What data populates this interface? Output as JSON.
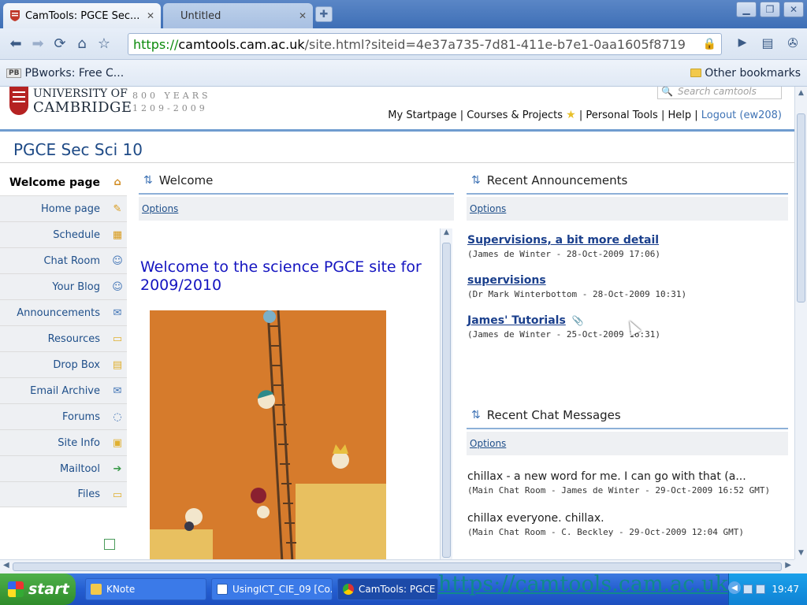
{
  "browser": {
    "tabs": [
      {
        "title": "CamTools: PGCE Sec...",
        "active": true
      },
      {
        "title": "Untitled",
        "active": false
      }
    ],
    "address": {
      "scheme": "https://",
      "host": "camtools.cam.ac.uk",
      "path": "/site.html?siteid=4e37a735-7d81-411e-b7e1-0aa1605f8719"
    },
    "bookmarks": {
      "left": "PBworks: Free C...",
      "left_badge": "PB",
      "right": "Other bookmarks"
    }
  },
  "header": {
    "university_line1": "UNIVERSITY OF",
    "university_line2": "CAMBRIDGE",
    "years_line1": "800 YEARS",
    "years_line2": "1209-2009",
    "search_placeholder": "Search camtools",
    "nav": {
      "startpage": "My Startpage",
      "courses": "Courses & Projects",
      "personal": "Personal Tools",
      "help": "Help",
      "logout": "Logout (ew208)"
    }
  },
  "site_title": "PGCE Sec Sci 10",
  "sidebar": {
    "items": [
      {
        "label": "Welcome page",
        "icon": "home-icon",
        "glyph": "⌂",
        "color": "#d08a1e"
      },
      {
        "label": "Home page",
        "icon": "pencil-icon",
        "glyph": "✎",
        "color": "#d89a1a"
      },
      {
        "label": "Schedule",
        "icon": "calendar-icon",
        "glyph": "▦",
        "color": "#d89a1a"
      },
      {
        "label": "Chat Room",
        "icon": "chat-person-icon",
        "glyph": "☺",
        "color": "#3f73b5"
      },
      {
        "label": "Your Blog",
        "icon": "blog-person-icon",
        "glyph": "☺",
        "color": "#3f73b5"
      },
      {
        "label": "Announcements",
        "icon": "megaphone-icon",
        "glyph": "✉",
        "color": "#3f73b5"
      },
      {
        "label": "Resources",
        "icon": "folder-icon",
        "glyph": "▭",
        "color": "#e0b030"
      },
      {
        "label": "Drop Box",
        "icon": "dropbox-icon",
        "glyph": "▤",
        "color": "#e0b030"
      },
      {
        "label": "Email Archive",
        "icon": "envelope-icon",
        "glyph": "✉",
        "color": "#3f73b5"
      },
      {
        "label": "Forums",
        "icon": "speech-bubble-icon",
        "glyph": "◌",
        "color": "#3f73b5"
      },
      {
        "label": "Site Info",
        "icon": "site-info-icon",
        "glyph": "▣",
        "color": "#e0b030"
      },
      {
        "label": "Mailtool",
        "icon": "mailtool-icon",
        "glyph": "➔",
        "color": "#3a9a4a"
      },
      {
        "label": "Files",
        "icon": "files-folder-icon",
        "glyph": "▭",
        "color": "#e0b030"
      }
    ]
  },
  "welcome": {
    "title": "Welcome",
    "options": "Options",
    "heading": "Welcome to the science PGCE site for 2009/2010"
  },
  "announcements": {
    "title": "Recent Announcements",
    "options": "Options",
    "items": [
      {
        "title": "Supervisions, a bit more detail",
        "meta": "(James de Winter - 28-Oct-2009 17:06)"
      },
      {
        "title": "supervisions",
        "meta": "(Dr Mark Winterbottom - 28-Oct-2009 10:31)"
      },
      {
        "title": "James' Tutorials",
        "meta": "(James de Winter - 25-Oct-2009 16:31)"
      }
    ]
  },
  "chat": {
    "title": "Recent Chat Messages",
    "options": "Options",
    "items": [
      {
        "text": "chillax - a new word for me. I can go with that (a...",
        "meta": "(Main Chat Room - James de Winter - 29-Oct-2009 16:52 GMT)"
      },
      {
        "text": "chillax everyone. chillax.",
        "meta": "(Main Chat Room - C. Beckley - 29-Oct-2009 12:04 GMT)"
      }
    ]
  },
  "taskbar": {
    "start": "start",
    "tasks": [
      "KNote",
      "UsingICT_CIE_09 [Co...",
      "CamTools: PGCE Sec..."
    ],
    "clock": "19:47",
    "status_url": "https://camtools.cam.ac.uk"
  }
}
